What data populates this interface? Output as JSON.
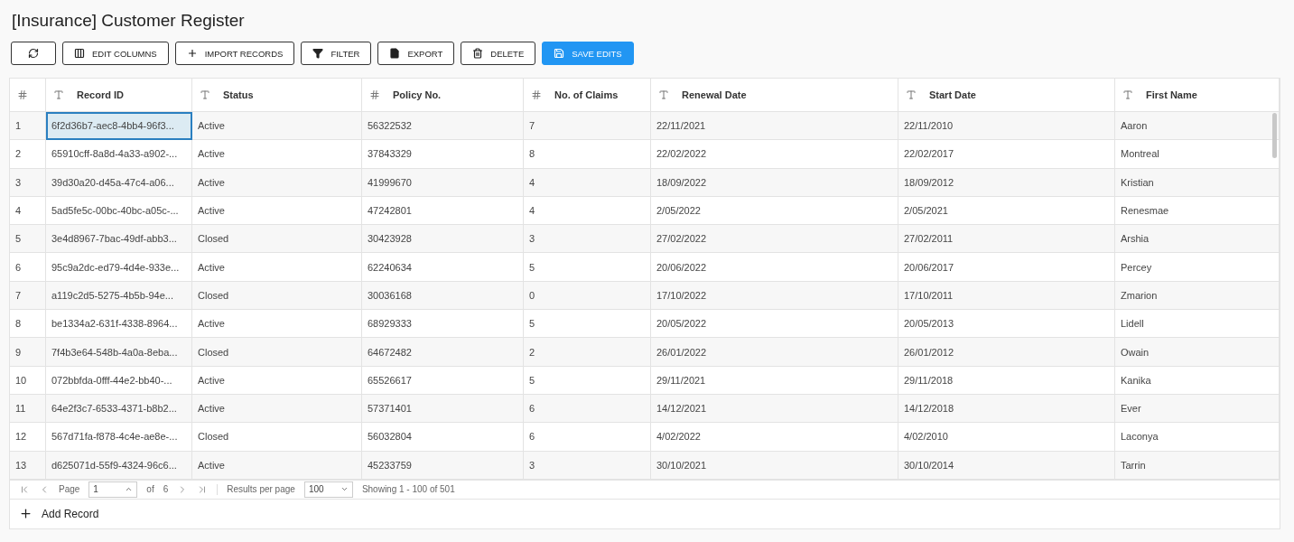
{
  "title": "[Insurance] Customer Register",
  "toolbar": [
    {
      "primary": false
    },
    {
      "label": "EDIT COLUMNS",
      "primary": false
    },
    {
      "label": "IMPORT RECORDS",
      "primary": false
    },
    {
      "label": "FILTER",
      "primary": false
    },
    {
      "label": "EXPORT",
      "primary": false
    },
    {
      "label": "DELETE",
      "primary": false
    },
    {
      "label": "SAVE EDITS",
      "primary": true
    }
  ],
  "table": {
    "columns": [
      {},
      {
        "label": "Record ID"
      },
      {
        "label": "Status"
      },
      {
        "label": "Policy No."
      },
      {
        "label": "No. of Claims"
      },
      {
        "label": "Renewal Date"
      },
      {
        "label": "Start Date"
      },
      {
        "label": "First Name"
      }
    ],
    "rows": [
      {
        "cells": [
          "1",
          "6f2d36b7-aec8-4bb4-96f3...",
          "Active",
          "56322532",
          "7",
          "22/11/2021",
          "22/11/2010",
          "Aaron"
        ],
        "focused": true
      },
      {
        "cells": [
          "2",
          "65910cff-8a8d-4a33-a902-...",
          "Active",
          "37843329",
          "8",
          "22/02/2022",
          "22/02/2017",
          "Montreal"
        ],
        "focused": false
      },
      {
        "cells": [
          "3",
          "39d30a20-d45a-47c4-a06...",
          "Active",
          "41999670",
          "4",
          "18/09/2022",
          "18/09/2012",
          "Kristian"
        ],
        "focused": false
      },
      {
        "cells": [
          "4",
          "5ad5fe5c-00bc-40bc-a05c-...",
          "Active",
          "47242801",
          "4",
          "2/05/2022",
          "2/05/2021",
          "Renesmae"
        ],
        "focused": false
      },
      {
        "cells": [
          "5",
          "3e4d8967-7bac-49df-abb3...",
          "Closed",
          "30423928",
          "3",
          "27/02/2022",
          "27/02/2011",
          "Arshia"
        ],
        "focused": false
      },
      {
        "cells": [
          "6",
          "95c9a2dc-ed79-4d4e-933e...",
          "Active",
          "62240634",
          "5",
          "20/06/2022",
          "20/06/2017",
          "Percey"
        ],
        "focused": false
      },
      {
        "cells": [
          "7",
          "a119c2d5-5275-4b5b-94e...",
          "Closed",
          "30036168",
          "0",
          "17/10/2022",
          "17/10/2011",
          "Zmarion"
        ],
        "focused": false
      },
      {
        "cells": [
          "8",
          "be1334a2-631f-4338-8964...",
          "Active",
          "68929333",
          "5",
          "20/05/2022",
          "20/05/2013",
          "Lidell"
        ],
        "focused": false
      },
      {
        "cells": [
          "9",
          "7f4b3e64-548b-4a0a-8eba...",
          "Closed",
          "64672482",
          "2",
          "26/01/2022",
          "26/01/2012",
          "Owain"
        ],
        "focused": false
      },
      {
        "cells": [
          "10",
          "072bbfda-0fff-44e2-bb40-...",
          "Active",
          "65526617",
          "5",
          "29/11/2021",
          "29/11/2018",
          "Kanika"
        ],
        "focused": false
      },
      {
        "cells": [
          "11",
          "64e2f3c7-6533-4371-b8b2...",
          "Active",
          "57371401",
          "6",
          "14/12/2021",
          "14/12/2018",
          "Ever"
        ],
        "focused": false
      },
      {
        "cells": [
          "12",
          "567d71fa-f878-4c4e-ae8e-...",
          "Closed",
          "56032804",
          "6",
          "4/02/2022",
          "4/02/2010",
          "Laconya"
        ],
        "focused": false
      },
      {
        "cells": [
          "13",
          "d625071d-55f9-4324-96c6...",
          "Active",
          "45233759",
          "3",
          "30/10/2021",
          "30/10/2014",
          "Tarrin"
        ],
        "focused": false
      }
    ]
  },
  "pager": {
    "page_label": "Page",
    "page": "1",
    "of_label": "of",
    "pages": "6",
    "per_page_label": "Results per page",
    "per_page": "100",
    "showing": "Showing 1 - 100 of 501"
  },
  "add_record": "Add Record"
}
